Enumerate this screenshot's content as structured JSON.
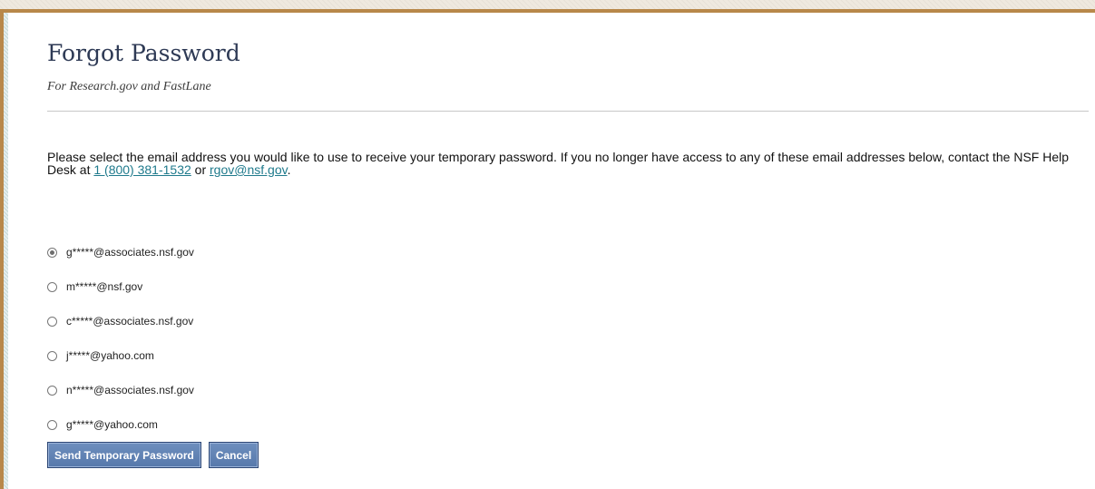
{
  "page": {
    "title": "Forgot Password",
    "subtitle": "For Research.gov and FastLane"
  },
  "instructions": {
    "text_before": "Please select the email address you would like to use to receive your temporary password. If you no longer have access to any of these email addresses below, contact the NSF Help Desk at ",
    "phone_link": "1 (800) 381-1532",
    "text_middle": " or ",
    "email_link": "rgov@nsf.gov",
    "text_after": "."
  },
  "email_options": [
    {
      "label": "g*****@associates.nsf.gov",
      "selected": true
    },
    {
      "label": "m*****@nsf.gov",
      "selected": false
    },
    {
      "label": "c*****@associates.nsf.gov",
      "selected": false
    },
    {
      "label": "j*****@yahoo.com",
      "selected": false
    },
    {
      "label": "n*****@associates.nsf.gov",
      "selected": false
    },
    {
      "label": "g*****@yahoo.com",
      "selected": false
    }
  ],
  "buttons": {
    "send_label": "Send Temporary Password",
    "cancel_label": "Cancel"
  },
  "colors": {
    "frame_border": "#b8884a",
    "title_text": "#2e3a55",
    "link": "#1f7a8c",
    "button_bg": "#5e80b3",
    "button_border": "#2c4674"
  }
}
